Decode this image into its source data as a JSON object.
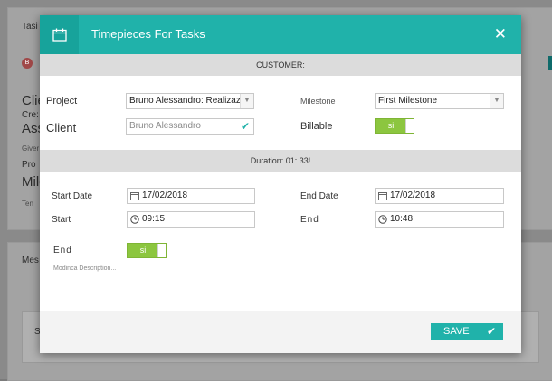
{
  "background": {
    "tab_label": "Tasi",
    "badge": "B",
    "labels": [
      "Clie",
      "Cre:",
      "Ass",
      "Giver",
      "Pro",
      "Mile",
      "Ten"
    ],
    "lower_label": "Mes",
    "inner_label": "S"
  },
  "modal": {
    "title": "Timepieces For Tasks",
    "close_symbol": "✕",
    "section_customer": "CUSTOMER:",
    "section_duration": "Duration: 01: 33!",
    "project": {
      "label": "Project",
      "value": "Bruno Alessandro: Realizaz"
    },
    "milestone": {
      "label": "Milestone",
      "value": "First Milestone"
    },
    "client": {
      "label": "Client",
      "value": "Bruno Alessandro"
    },
    "billable": {
      "label": "Billable",
      "toggle": "si"
    },
    "start_date": {
      "label": "Start Date",
      "value": "17/02/2018"
    },
    "end_date": {
      "label": "End Date",
      "value": "17/02/2018"
    },
    "start": {
      "label": "Start",
      "value": "09:15"
    },
    "end": {
      "label": "End",
      "value": "10:48"
    },
    "end_toggle": {
      "label": "End",
      "toggle": "si"
    },
    "description_link": "Modinca Description...",
    "save_label": "SAVE",
    "accent_color": "#20b2aa",
    "toggle_color": "#8cc63f"
  }
}
